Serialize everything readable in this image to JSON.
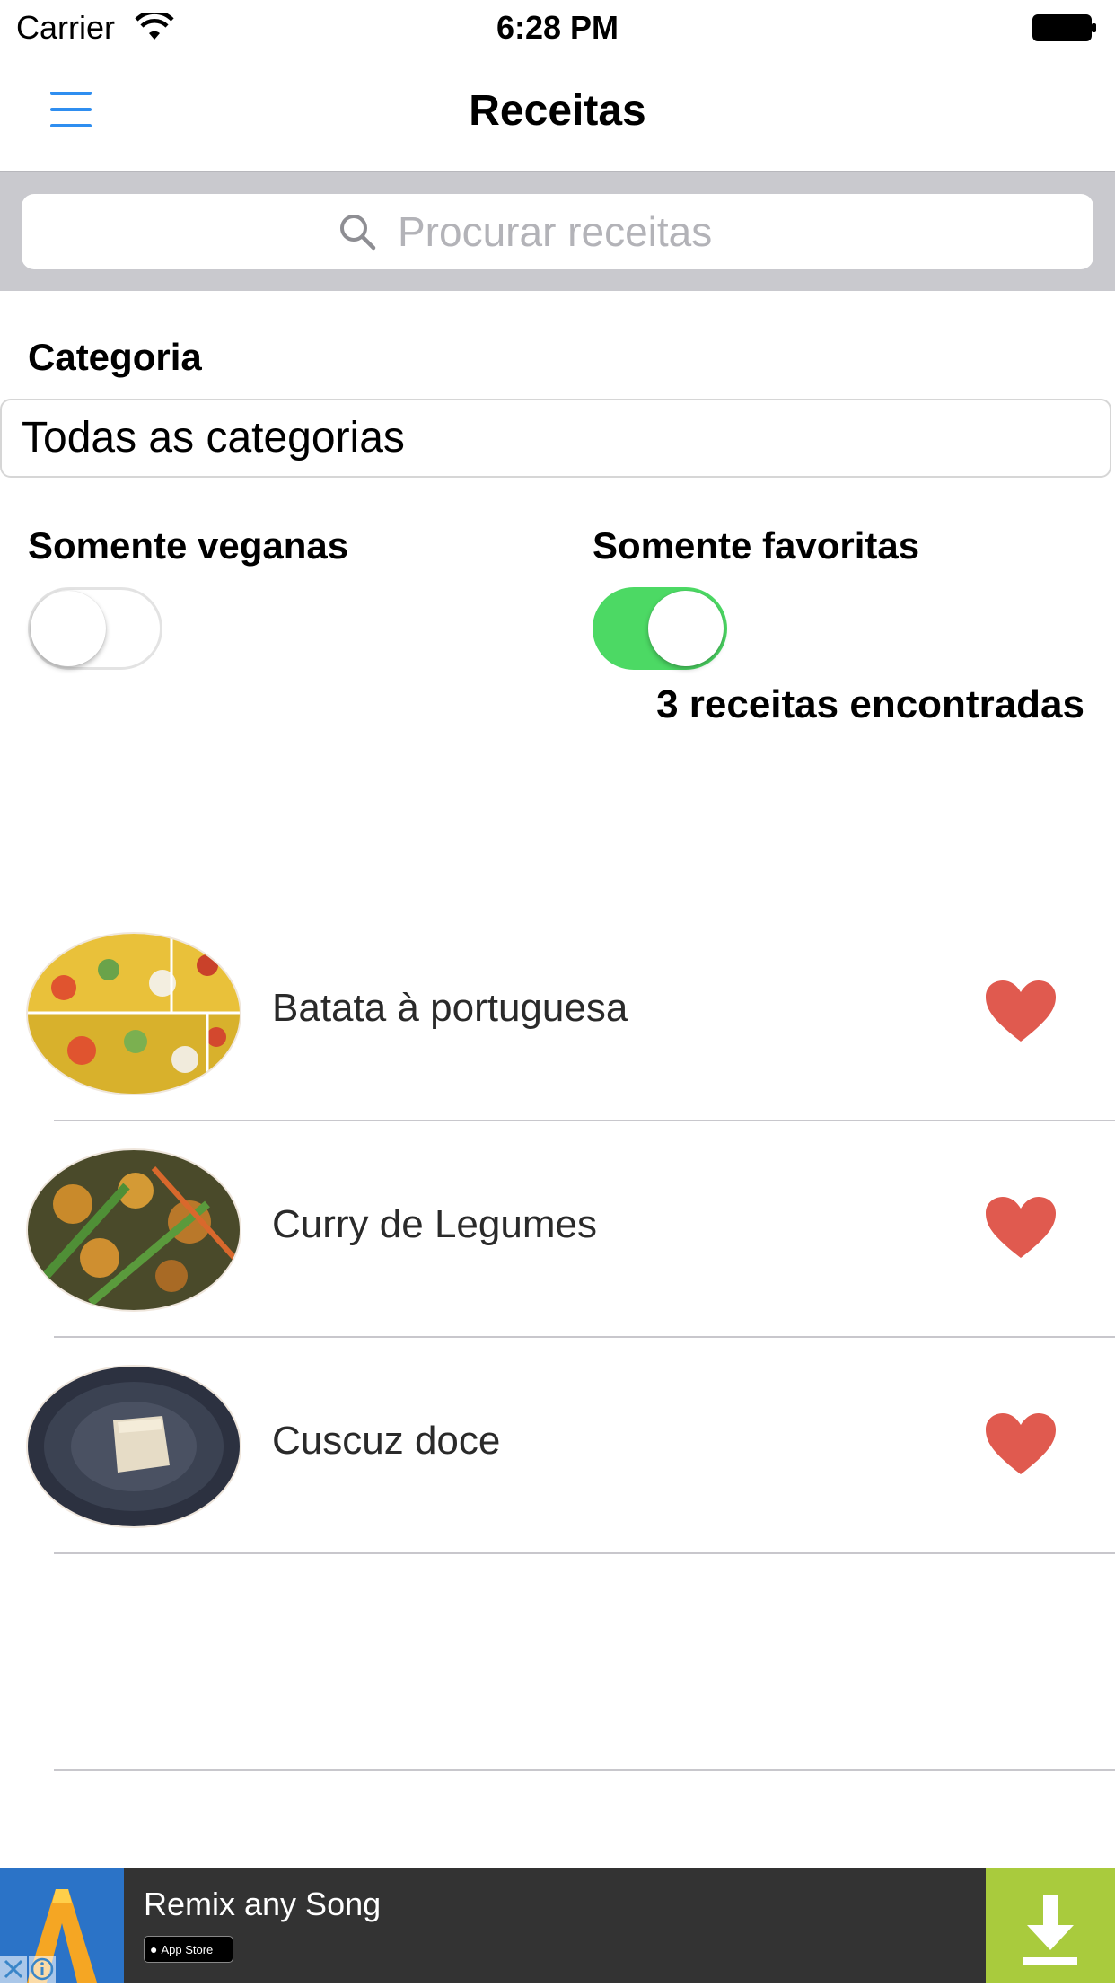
{
  "status_bar": {
    "carrier": "Carrier",
    "time": "6:28 PM"
  },
  "nav": {
    "title": "Receitas",
    "menu_icon": "hamburger-menu-icon"
  },
  "search": {
    "placeholder": "Procurar receitas",
    "value": ""
  },
  "filters": {
    "category_label": "Categoria",
    "category_value": "Todas as categorias",
    "vegan_label": "Somente veganas",
    "vegan_on": false,
    "favorites_label": "Somente favoritas",
    "favorites_on": true
  },
  "results_count": "3 receitas encontradas",
  "recipes": [
    {
      "name": "Batata à portuguesa",
      "favorite": true
    },
    {
      "name": "Curry de Legumes",
      "favorite": true
    },
    {
      "name": "Cuscuz doce",
      "favorite": true
    }
  ],
  "ad": {
    "title": "Remix any Song",
    "store_badge": "App Store"
  },
  "colors": {
    "accent": "#2f8ef0",
    "toggle_on": "#4cd964",
    "heart": "#e05a4f",
    "ad_download": "#a9cb3d"
  }
}
